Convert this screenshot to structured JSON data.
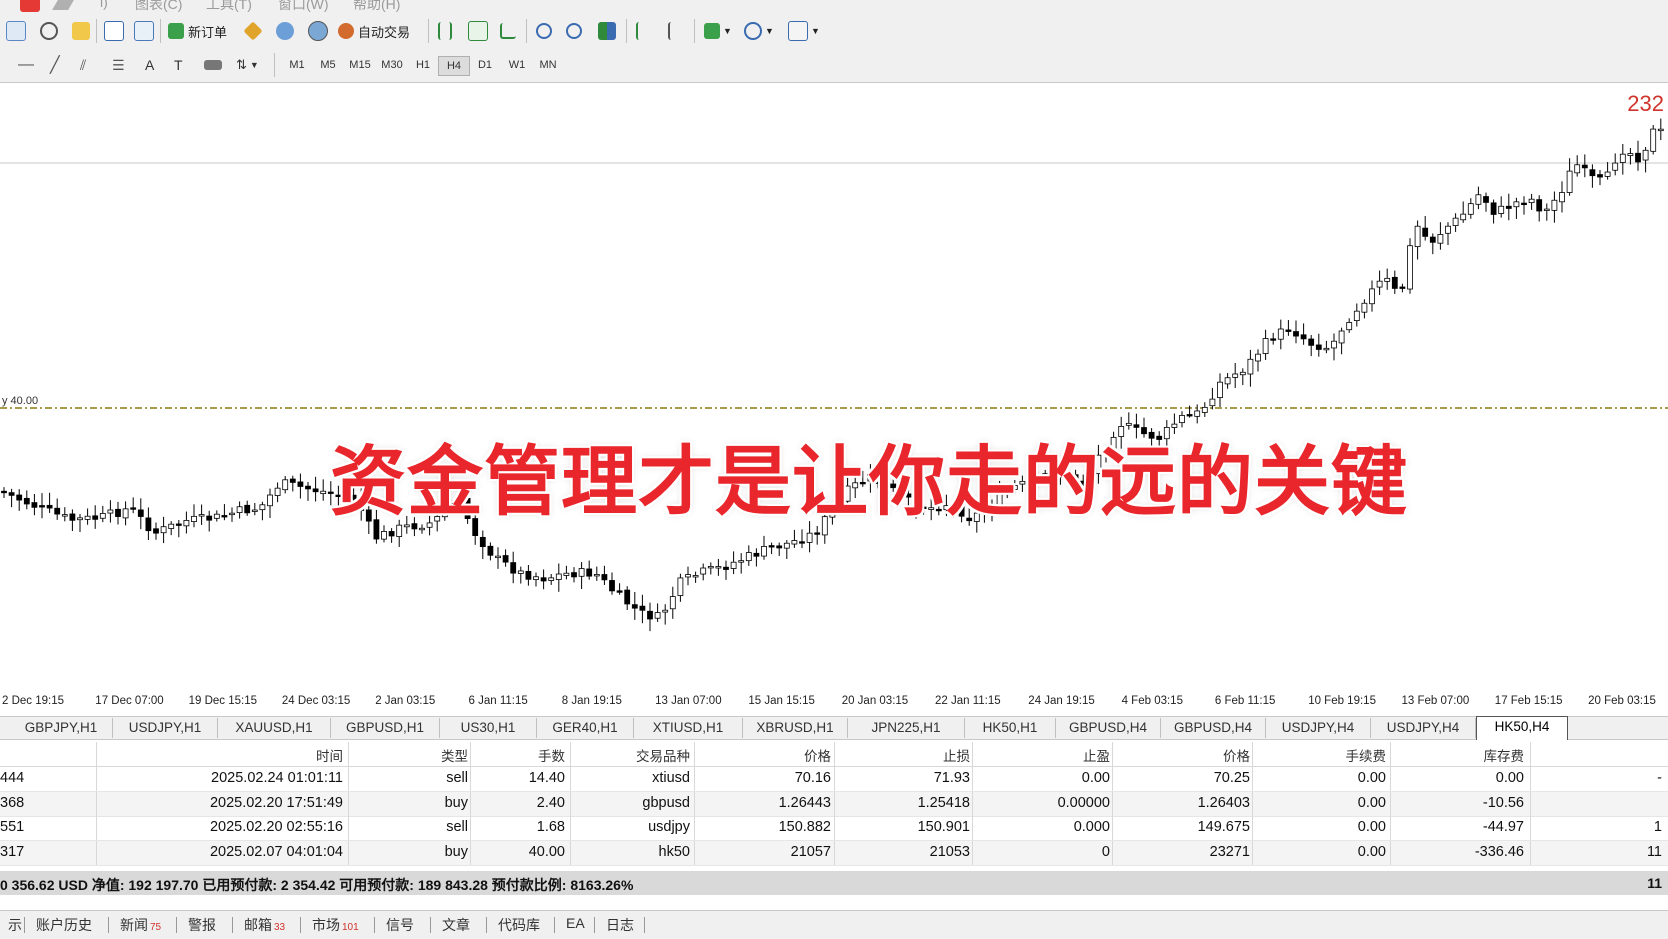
{
  "menu": {
    "items": [
      "i)",
      "图表(C)",
      "工具(T)",
      "窗口(W)",
      "帮助(H)"
    ]
  },
  "toolbar": {
    "new_order_label": "新订单",
    "auto_trade_label": "自动交易",
    "timeframes": [
      "M1",
      "M5",
      "M15",
      "M30",
      "H1",
      "H4",
      "D1",
      "W1",
      "MN"
    ],
    "active_timeframe": "H4"
  },
  "chart": {
    "symbol_tab": "HK50,H4",
    "price_label": "232",
    "level_label": "y 40.00",
    "overlay_text": "资金管理才是让你走的远的关键",
    "time_ticks": [
      "2 Dec 19:15",
      "17 Dec 07:00",
      "19 Dec 15:15",
      "24 Dec 03:15",
      "2 Jan 03:15",
      "6 Jan 11:15",
      "8 Jan 19:15",
      "13 Jan 07:00",
      "15 Jan 15:15",
      "20 Jan 03:15",
      "22 Jan 11:15",
      "24 Jan 19:15",
      "4 Feb 03:15",
      "6 Feb 11:15",
      "10 Feb 19:15",
      "13 Feb 07:00",
      "17 Feb 15:15",
      "20 Feb 03:15"
    ],
    "colors": {
      "candle": "#000000",
      "level_line": "#8a7a10",
      "price_text": "#d0342c",
      "overlay": "#e8262b"
    }
  },
  "chart_tabs": [
    "GBPJPY,H1",
    "USDJPY,H1",
    "XAUUSD,H1",
    "GBPUSD,H1",
    "US30,H1",
    "GER40,H1",
    "XTIUSD,H1",
    "XBRUSD,H1",
    "JPN225,H1",
    "HK50,H1",
    "GBPUSD,H4",
    "GBPUSD,H4",
    "USDJPY,H4",
    "USDJPY,H4",
    "HK50,H4"
  ],
  "active_chart_tab": "HK50,H4",
  "table": {
    "headers": [
      "时间",
      "类型",
      "手数",
      "交易品种",
      "价格",
      "止损",
      "止盈",
      "价格",
      "手续费",
      "库存费"
    ],
    "rows": [
      {
        "id": "444",
        "time": "2025.02.24 01:01:11",
        "type": "sell",
        "lots": "14.40",
        "symbol": "xtiusd",
        "price": "70.16",
        "sl": "71.93",
        "tp": "0.00",
        "cur_price": "70.25",
        "commission": "0.00",
        "swap": "0.00",
        "profit": "-"
      },
      {
        "id": "368",
        "time": "2025.02.20 17:51:49",
        "type": "buy",
        "lots": "2.40",
        "symbol": "gbpusd",
        "price": "1.26443",
        "sl": "1.25418",
        "tp": "0.00000",
        "cur_price": "1.26403",
        "commission": "0.00",
        "swap": "-10.56",
        "profit": ""
      },
      {
        "id": "551",
        "time": "2025.02.20 02:55:16",
        "type": "sell",
        "lots": "1.68",
        "symbol": "usdjpy",
        "price": "150.882",
        "sl": "150.901",
        "tp": "0.000",
        "cur_price": "149.675",
        "commission": "0.00",
        "swap": "-44.97",
        "profit": "1"
      },
      {
        "id": "317",
        "time": "2025.02.07 04:01:04",
        "type": "buy",
        "lots": "40.00",
        "symbol": "hk50",
        "price": "21057",
        "sl": "21053",
        "tp": "0",
        "cur_price": "23271",
        "commission": "0.00",
        "swap": "-336.46",
        "profit": "11"
      }
    ],
    "summary": "0 356.62 USD  净值: 192 197.70  已用预付款: 2 354.42  可用预付款: 189 843.28  预付款比例: 8163.26%",
    "summary_value": "11"
  },
  "bottom_tabs": [
    {
      "label": "示",
      "count": ""
    },
    {
      "label": "账户历史",
      "count": ""
    },
    {
      "label": "新闻",
      "count": "75"
    },
    {
      "label": "警报",
      "count": ""
    },
    {
      "label": "邮箱",
      "count": "33"
    },
    {
      "label": "市场",
      "count": "101"
    },
    {
      "label": "信号",
      "count": ""
    },
    {
      "label": "文章",
      "count": ""
    },
    {
      "label": "代码库",
      "count": ""
    },
    {
      "label": "EA",
      "count": ""
    },
    {
      "label": "日志",
      "count": ""
    }
  ]
}
